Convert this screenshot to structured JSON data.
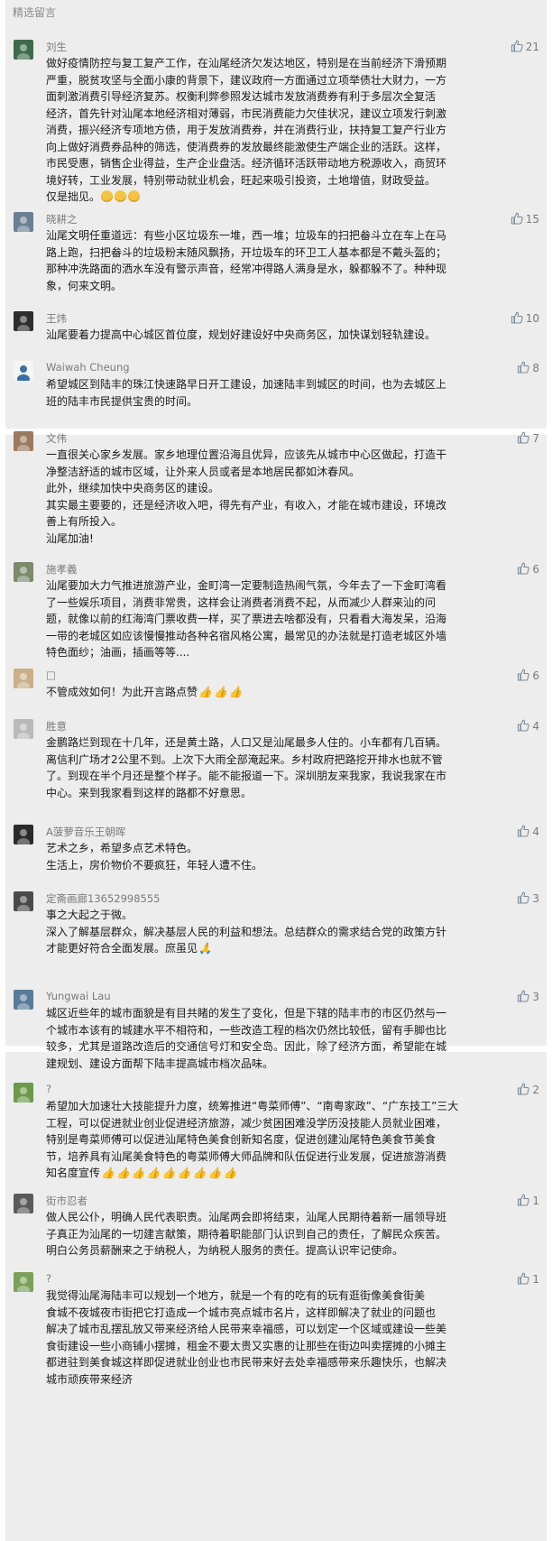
{
  "section_title": "精选留言",
  "comments": [
    {
      "name": "刘生",
      "likes": "21",
      "lines": [
        "做好疫情防控与复工复产工作，在汕尾经济欠发达地区，特别是在当前经济下滑预期",
        "严重，脱贫攻坚与全面小康的背景下，建议政府一方面通过立项举债壮大财力，一方",
        "面刺激消费引导经济复苏。权衡利弊参照发达城市发放消费券有利于多层次全复活",
        "经济，首先针对汕尾本地经济相对薄弱，市民消费能力欠佳状况，建议立项发行刺激",
        "消费，振兴经济专项地方债，用于发放消费券，并在消费行业，扶持复工复产行业方",
        "向上做好消费券品种的筛选，使消费券的发放最终能激使生产端企业的活跃。这样，",
        "市民受惠，销售企业得益，生产企业盘活。经济循环活跃带动地方税源收入，商贸环",
        "境好转，工业发展，特别带动就业机会，旺起来吸引投资，土地增值，财政受益。",
        "    仅是拙见。"
      ]
    },
    {
      "name": "晓耕之",
      "likes": "15",
      "lines": [
        "汕尾文明任重道远：有些小区垃圾东一堆，西一堆；垃圾车的扫把畚斗立在车上在马",
        "路上跑，扫把畚斗的垃圾粉末随风飘扬，开垃圾车的环卫工人基本都是不戴头盔的；",
        "那种冲洗路面的洒水车没有警示声音，经常冲得路人满身是水，躲都躲不了。种种现",
        "象，何来文明。"
      ]
    },
    {
      "name": "王炜",
      "likes": "10",
      "lines": [
        "汕尾要着力提高中心城区首位度，规划好建设好中央商务区，加快谋划轻轨建设。"
      ]
    },
    {
      "name": "Waiwah Cheung",
      "likes": "8",
      "lines": [
        "希望城区到陆丰的珠江快速路早日开工建设，加速陆丰到城区的时间，也为去城区上",
        "班的陆丰市民提供宝贵的时间。"
      ]
    },
    {
      "name": "文伟",
      "likes": "7",
      "lines": [
        "一直很关心家乡发展。家乡地理位置沿海且优异，应该先从城市中心区做起，打造干",
        "净整洁舒适的城市区域，让外来人员或者是本地居民都如沐春风。",
        "此外，继续加快中央商务区的建设。",
        "其实最主要要的，还是经济收入吧，得先有产业，有收入，才能在城市建设，环境改",
        "善上有所投入。",
        "汕尾加油!"
      ]
    },
    {
      "name": "施孝義",
      "likes": "6",
      "lines": [
        "汕尾要加大力气推进旅游产业，金町湾一定要制造热闹气氛，今年去了一下金町湾看",
        "了一些娱乐项目，消费非常贵，这样会让消费者消费不起，从而减少人群来汕的问",
        "题，就像以前的红海湾门票收费一样，买了票进去啥都没有，只看看大海发呆，沿海",
        "一带的老城区如应该慢慢推动各种名宿风格公寓，最常见的办法就是打造老城区外墙",
        "特色面纱；油画，插画等等...."
      ]
    },
    {
      "name": "□",
      "likes": "6",
      "lines": [
        "不管成效如何！为此开言路点赞"
      ]
    },
    {
      "name": "胜意",
      "likes": "4",
      "lines": [
        "金鹏路烂到现在十几年，还是黄土路，人口又是汕尾最多人住的。小车都有几百辆。",
        "离信利广场才2公里不到。上次下大雨全部淹起来。乡村政府把路挖开排水也就不管",
        "了。到现在半个月还是整个样子。能不能报道一下。深圳朋友来我家，我说我家在市",
        "中心。来到我家看到这样的路都不好意思。"
      ]
    },
    {
      "name": "A菠萝音乐王朝晖",
      "likes": "4",
      "lines": [
        "艺术之乡，希望多点艺术特色。",
        "生活上，房价物价不要疯狂，年轻人遭不住。"
      ]
    },
    {
      "name": "定斋画廊13652998555",
      "likes": "3",
      "lines": [
        "事之大起之于微。",
        "深入了解基层群众，解决基层人民的利益和想法。总结群众的需求结合党的政策方针",
        "才能更好符合全面发展。庶虽见"
      ]
    },
    {
      "name": "Yungwai Lau",
      "likes": "3",
      "lines": [
        "城区近些年的城市面貌是有目共睹的发生了变化，但是下辖的陆丰市的市区仍然与一",
        "个城市本该有的城建水平不相符和，一些改造工程的档次仍然比较低，留有手脚也比",
        "较多，尤其是道路改造后的交通信号灯和安全岛。因此，除了经济方面，希望能在城",
        "建规划、建设方面帮下陆丰提高城市档次品味。"
      ]
    },
    {
      "name": "?",
      "likes": "2",
      "lines": [
        "希望加大加速壮大技能提升力度，统筹推进“粤菜师傅”、“南粤家政”、“广东技工”三大",
        "工程，可以促进就业创业促进经济旅游，减少贫困困难没学历没技能人员就业困难，",
        "特别是粤菜师傅可以促进汕尾特色美食创新知名度，促进创建汕尾特色美食节美食",
        "节，培养具有汕尾美食特色的粤菜师傅大师品牌和队伍促进行业发展，促进旅游消费",
        "知名度宣传"
      ]
    },
    {
      "name": "街市忍者",
      "likes": "1",
      "lines": [
        "做人民公仆，明确人民代表职责。汕尾两会即将结束，汕尾人民期待着新一届领导班",
        "子真正为汕尾的一切建言献策，期待着职能部门认识到自己的责任，了解民众疾苦。",
        "明白公务员薪酬来之于纳税人，为纳税人服务的责任。提高认识牢记使命。"
      ]
    },
    {
      "name": "?",
      "likes": "1",
      "lines": [
        "我觉得汕尾海陆丰可以规划一个地方，就是一个有的吃有的玩有逛街像美食街美",
        "食城不夜城夜市街把它打造成一个城市亮点城市名片，这样即解决了就业的问题也",
        "解决了城市乱摆乱放又带来经济给人民带来幸福感，可以划定一个区域或建设一些美",
        "食街建设一些小商铺小摆摊，租金不要太贵又实惠的让那些在街边叫卖摆摊的小摊主",
        "都进驻到美食城这样即促进就业创业也市民带来好去处幸福感带来乐趣快乐，也解决",
        "城市顽疾带来经济"
      ]
    }
  ],
  "icons": {
    "like": "thumbs-up-icon",
    "smile": "smile-emoji-icon",
    "thumb_emoji": "thumbs-up-emoji-icon"
  },
  "colors": {
    "panel_bg": "#ededed",
    "like_icon": "#8a8a8a",
    "name": "#7a7a7a"
  }
}
